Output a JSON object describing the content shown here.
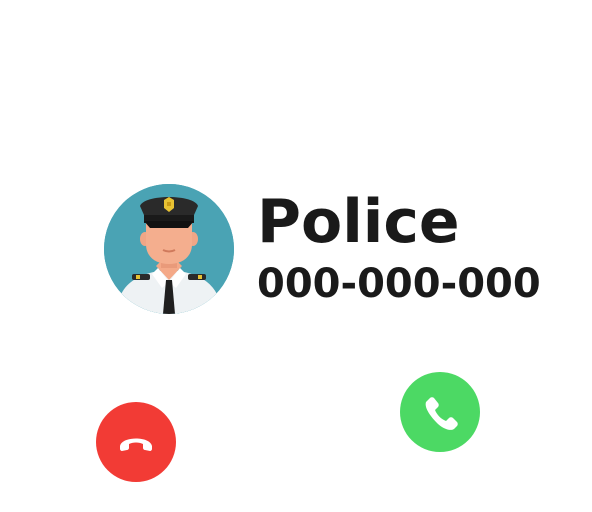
{
  "caller": {
    "name": "Police",
    "number": "000-000-000"
  },
  "avatar": {
    "icon": "police-officer-avatar",
    "background_color": "#4aa3b4"
  },
  "actions": {
    "decline": {
      "icon": "phone-hangup-icon",
      "color": "#f23b35"
    },
    "accept": {
      "icon": "phone-icon",
      "color": "#4cd964"
    }
  }
}
